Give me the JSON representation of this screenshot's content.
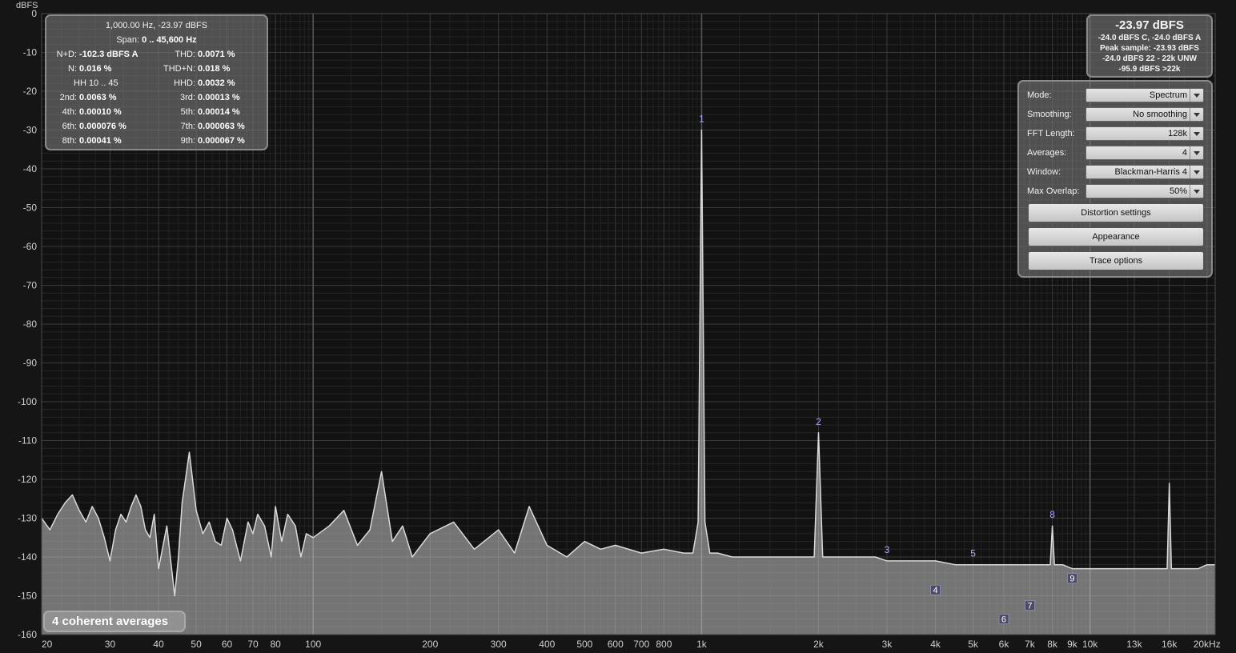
{
  "unit_label": "dBFS",
  "info": {
    "title": "1,000.00 Hz, -23.97 dBFS",
    "span_label": "Span:",
    "span_value": "0 .. 45,600 Hz",
    "rows": [
      [
        {
          "label": "N+D:",
          "value": "-102.3 dBFS A"
        },
        {
          "label": "THD:",
          "value": "0.0071 %"
        }
      ],
      [
        {
          "label": "N:",
          "value": "0.016 %"
        },
        {
          "label": "THD+N:",
          "value": "0.018 %"
        }
      ],
      [
        {
          "label": "HH 10 .. 45",
          "value": ""
        },
        {
          "label": "HHD:",
          "value": "0.0032 %"
        }
      ],
      [
        {
          "label": "2nd:",
          "value": "0.0063 %"
        },
        {
          "label": "3rd:",
          "value": "0.00013 %"
        }
      ],
      [
        {
          "label": "4th:",
          "value": "0.00010 %"
        },
        {
          "label": "5th:",
          "value": "0.00014 %"
        }
      ],
      [
        {
          "label": "6th:",
          "value": "0.000076 %"
        },
        {
          "label": "7th:",
          "value": "0.000063 %"
        }
      ],
      [
        {
          "label": "8th:",
          "value": "0.00041 %"
        },
        {
          "label": "9th:",
          "value": "0.000067 %"
        }
      ]
    ]
  },
  "level": {
    "main": "-23.97 dBFS",
    "lines": [
      "-24.0 dBFS C, -24.0 dBFS A",
      "Peak sample: -23.93 dBFS",
      "-24.0 dBFS 22 - 22k UNW",
      "-95.9 dBFS >22k"
    ]
  },
  "settings": {
    "fields": [
      {
        "label": "Mode:",
        "value": "Spectrum"
      },
      {
        "label": "Smoothing:",
        "value": "No  smoothing"
      },
      {
        "label": "FFT Length:",
        "value": "128k"
      },
      {
        "label": "Averages:",
        "value": "4"
      },
      {
        "label": "Window:",
        "value": "Blackman-Harris 4"
      },
      {
        "label": "Max Overlap:",
        "value": "50%"
      }
    ],
    "buttons": [
      "Distortion settings",
      "Appearance",
      "Trace options"
    ]
  },
  "averages_badge": "4 coherent averages",
  "colors": {
    "trace": "#d9d9d9",
    "fill": "#c4c4c4",
    "grid": "#3a3a3a",
    "marker": "#a7a7ff"
  },
  "chart_data": {
    "type": "line",
    "xlabel": "",
    "ylabel": "dBFS",
    "x_scale": "log",
    "xlim": [
      20,
      21000
    ],
    "ylim": [
      -160,
      0
    ],
    "x_ticks": [
      20,
      30,
      40,
      50,
      60,
      70,
      80,
      100,
      200,
      300,
      400,
      500,
      600,
      700,
      800,
      1000,
      2000,
      3000,
      4000,
      5000,
      6000,
      7000,
      8000,
      9000,
      10000,
      13000,
      16000,
      20000
    ],
    "x_tick_labels": [
      "20",
      "30",
      "40",
      "50",
      "60",
      "70",
      "80",
      "100",
      "200",
      "300",
      "400",
      "500",
      "600",
      "700",
      "800",
      "1k",
      "2k",
      "3k",
      "4k",
      "5k",
      "6k",
      "7k",
      "8k",
      "9k",
      "10k",
      "13k",
      "16k",
      "20kHz"
    ],
    "y_ticks": [
      0,
      -10,
      -20,
      -30,
      -40,
      -50,
      -60,
      -70,
      -80,
      -90,
      -100,
      -110,
      -120,
      -130,
      -140,
      -150,
      -160
    ],
    "y_tick_labels": [
      "0",
      "-10",
      "-20",
      "-30",
      "-40",
      "-50",
      "-60",
      "-70",
      "-80",
      "-90",
      "-100",
      "-110",
      "-120",
      "-130",
      "-140",
      "-150",
      "-160"
    ],
    "grid": true,
    "series": [
      {
        "x": [
          20,
          21,
          22,
          23,
          24,
          25,
          26,
          27,
          28,
          29,
          30,
          31,
          32,
          33,
          34,
          35,
          36,
          37,
          38,
          39,
          40,
          42,
          44,
          45,
          46,
          48,
          50,
          52,
          54,
          56,
          58,
          60,
          62,
          65,
          68,
          70,
          72,
          75,
          78,
          80,
          83,
          86,
          90,
          93,
          96,
          100,
          110,
          120,
          130,
          140,
          150,
          160,
          170,
          180,
          200,
          230,
          260,
          300,
          330,
          360,
          400,
          450,
          500,
          550,
          600,
          700,
          800,
          900,
          950,
          980,
          1000,
          1020,
          1050,
          1100,
          1200,
          1400,
          1600,
          1800,
          1950,
          2000,
          2050,
          2200,
          2500,
          2800,
          3000,
          3300,
          3600,
          4000,
          4500,
          5000,
          5500,
          6000,
          6500,
          7000,
          7500,
          7900,
          8000,
          8100,
          8500,
          9000,
          10000,
          11000,
          12000,
          13000,
          14000,
          15000,
          15800,
          16000,
          16200,
          17000,
          18000,
          19000,
          20000,
          21000
        ],
        "y": [
          -130,
          -133,
          -129,
          -126,
          -124,
          -128,
          -131,
          -127,
          -130,
          -135,
          -141,
          -133,
          -129,
          -131,
          -127,
          -124,
          -127,
          -133,
          -135,
          -129,
          -143,
          -132,
          -150,
          -140,
          -126,
          -113,
          -128,
          -134,
          -131,
          -136,
          -137,
          -130,
          -133,
          -141,
          -131,
          -134,
          -129,
          -132,
          -140,
          -127,
          -136,
          -129,
          -132,
          -140,
          -134,
          -135,
          -132,
          -128,
          -137,
          -133,
          -118,
          -136,
          -132,
          -140,
          -134,
          -131,
          -138,
          -133,
          -139,
          -127,
          -137,
          -140,
          -136,
          -138,
          -137,
          -139,
          -138,
          -139,
          -139,
          -131,
          -30,
          -131,
          -139,
          -139,
          -140,
          -140,
          -140,
          -140,
          -140,
          -108,
          -140,
          -140,
          -140,
          -140,
          -141,
          -141,
          -141,
          -141,
          -142,
          -142,
          -142,
          -142,
          -142,
          -142,
          -142,
          -142,
          -132,
          -142,
          -142,
          -143,
          -143,
          -143,
          -143,
          -143,
          -143,
          -143,
          -143,
          -121,
          -143,
          -143,
          -143,
          -143,
          -142,
          -142
        ]
      }
    ],
    "markers": [
      {
        "label": "1",
        "x": 1000,
        "y": -30,
        "boxed": false
      },
      {
        "label": "2",
        "x": 2000,
        "y": -108,
        "boxed": false
      },
      {
        "label": "3",
        "x": 3000,
        "y": -141,
        "boxed": false
      },
      {
        "label": "4",
        "x": 4000,
        "y": -148.5,
        "boxed": true
      },
      {
        "label": "5",
        "x": 5000,
        "y": -142,
        "boxed": false
      },
      {
        "label": "6",
        "x": 6000,
        "y": -156,
        "boxed": true
      },
      {
        "label": "7",
        "x": 7000,
        "y": -152.5,
        "boxed": true
      },
      {
        "label": "8",
        "x": 8000,
        "y": -132,
        "boxed": false
      },
      {
        "label": "9",
        "x": 9000,
        "y": -145.5,
        "boxed": true
      }
    ]
  }
}
